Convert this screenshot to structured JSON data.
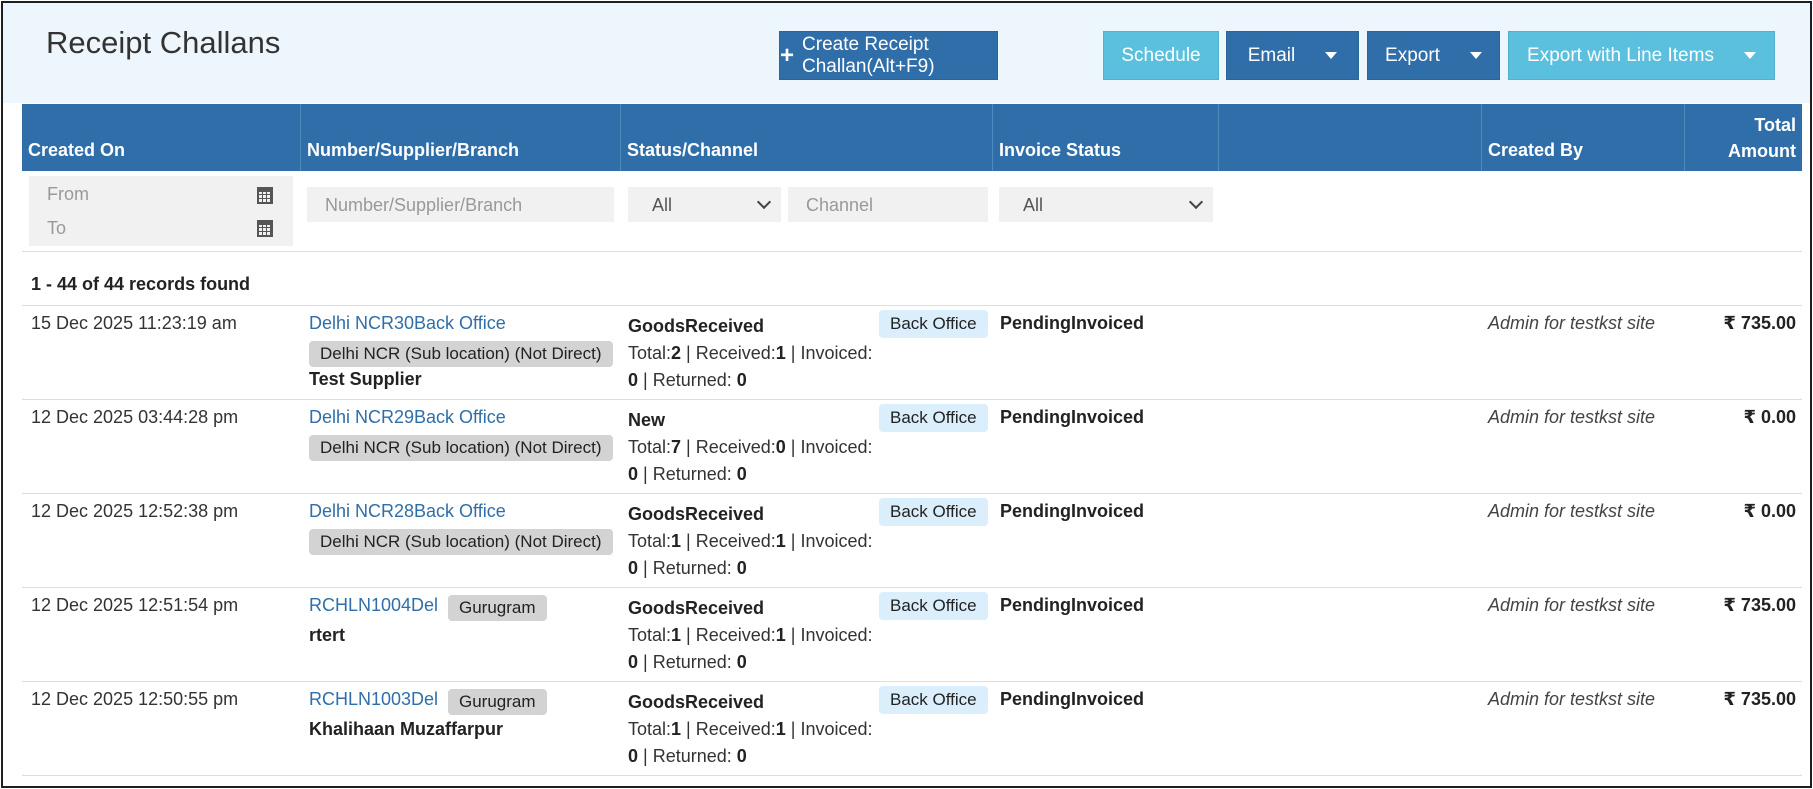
{
  "page": {
    "title": "Receipt Challans"
  },
  "toolbar": {
    "create_label": "Create Receipt Challan(Alt+F9)",
    "schedule_label": "Schedule",
    "email_label": "Email",
    "export_label": "Export",
    "export_lines_label": "Export with Line Items"
  },
  "table": {
    "headers": {
      "created_on": "Created On",
      "number": "Number/Supplier/Branch",
      "status": "Status/Channel",
      "invoice_status": "Invoice Status",
      "blank": "",
      "created_by": "Created By",
      "total_line1": "Total",
      "total_line2": "Amount"
    },
    "filters": {
      "from_placeholder": "From",
      "to_placeholder": "To",
      "number_placeholder": "Number/Supplier/Branch",
      "status_value": "All",
      "channel_placeholder": "Channel",
      "invoice_value": "All"
    },
    "records_found": "1 - 44 of 44 records found",
    "rows": [
      {
        "date": "15 Dec 2025 11:23:19 am",
        "number": "Delhi NCR30Back Office",
        "branch": "Delhi NCR (Sub location) (Not Direct)",
        "supplier": "Test Supplier",
        "status": "GoodsReceived",
        "total": "2",
        "received": "1",
        "invoiced": "0",
        "returned": "0",
        "channel": "Back Office",
        "invoice_status": "PendingInvoiced",
        "created_by": "Admin for testkst site",
        "amount": "₹ 735.00"
      },
      {
        "date": "12 Dec 2025 03:44:28 pm",
        "number": "Delhi NCR29Back Office",
        "branch": "Delhi NCR (Sub location) (Not Direct)",
        "supplier": "",
        "status": "New",
        "total": "7",
        "received": "0",
        "invoiced": "0",
        "returned": "0",
        "channel": "Back Office",
        "invoice_status": "PendingInvoiced",
        "created_by": "Admin for testkst site",
        "amount": "₹ 0.00"
      },
      {
        "date": "12 Dec 2025 12:52:38 pm",
        "number": "Delhi NCR28Back Office",
        "branch": "Delhi NCR (Sub location) (Not Direct)",
        "supplier": "",
        "status": "GoodsReceived",
        "total": "1",
        "received": "1",
        "invoiced": "0",
        "returned": "0",
        "channel": "Back Office",
        "invoice_status": "PendingInvoiced",
        "created_by": "Admin for testkst site",
        "amount": "₹ 0.00"
      },
      {
        "date": "12 Dec 2025 12:51:54 pm",
        "number": "RCHLN1004Del",
        "branch": "Gurugram",
        "supplier": "rtert",
        "status": "GoodsReceived",
        "total": "1",
        "received": "1",
        "invoiced": "0",
        "returned": "0",
        "channel": "Back Office",
        "invoice_status": "PendingInvoiced",
        "created_by": "Admin for testkst site",
        "amount": "₹ 735.00"
      },
      {
        "date": "12 Dec 2025 12:50:55 pm",
        "number": "RCHLN1003Del",
        "branch": "Gurugram",
        "supplier": "Khalihaan Muzaffarpur",
        "status": "GoodsReceived",
        "total": "1",
        "received": "1",
        "invoiced": "0",
        "returned": "0",
        "channel": "Back Office",
        "invoice_status": "PendingInvoiced",
        "created_by": "Admin for testkst site",
        "amount": "₹ 735.00"
      }
    ],
    "labels": {
      "total": "Total:",
      "received": "Received:",
      "invoiced": "Invoiced:",
      "returned": "Returned:"
    }
  },
  "icons": {
    "plus": "plus-icon",
    "calendar": "calendar-icon",
    "caret": "caret-down-icon"
  },
  "colors": {
    "primary": "#2f6ea8",
    "info": "#5bc0de",
    "header_bg": "#eef6fd",
    "channel_badge": "#dbeefc",
    "branch_badge": "#d3d3d3"
  }
}
